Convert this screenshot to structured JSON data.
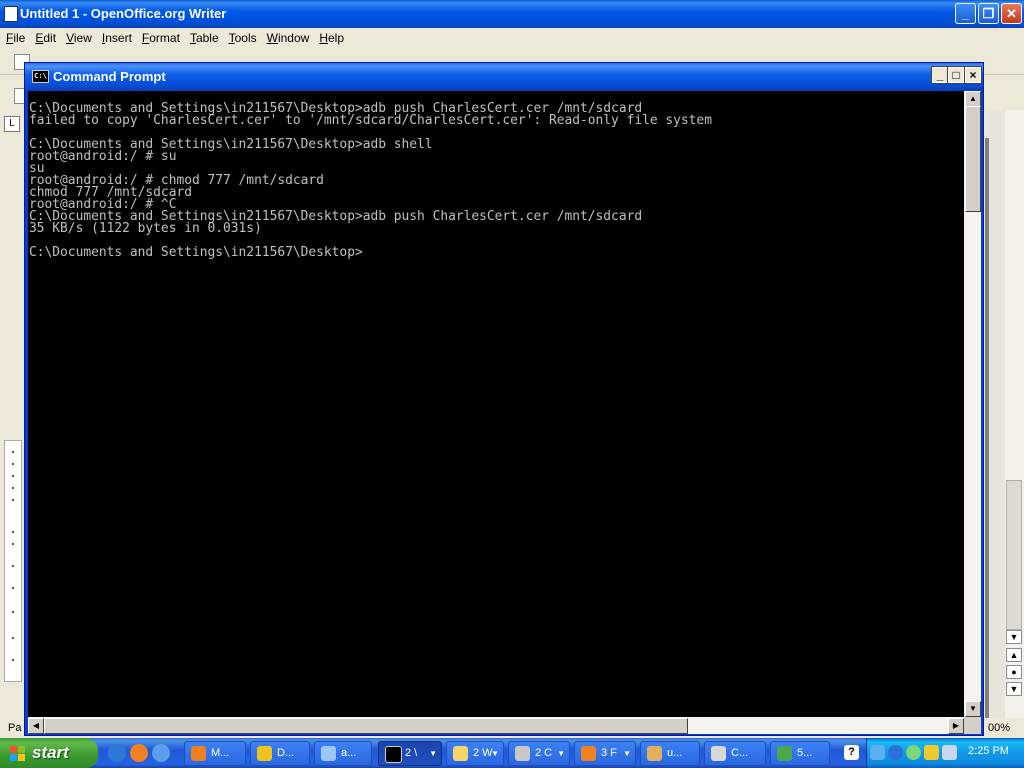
{
  "writer": {
    "title": "Untitled 1 - OpenOffice.org Writer",
    "menu": [
      "File",
      "Edit",
      "View",
      "Insert",
      "Format",
      "Table",
      "Tools",
      "Window",
      "Help"
    ],
    "status_page": "Pa",
    "zoom": "00%",
    "controls": {
      "minimize": "_",
      "restore": "❐",
      "close": "✕"
    }
  },
  "cmd": {
    "title": "Command Prompt",
    "icon_text": "C:\\",
    "controls": {
      "minimize": "_",
      "maximize": "□",
      "close": "×"
    },
    "lines": [
      "C:\\Documents and Settings\\in211567\\Desktop>adb push CharlesCert.cer /mnt/sdcard",
      "failed to copy 'CharlesCert.cer' to '/mnt/sdcard/CharlesCert.cer': Read-only file system",
      "",
      "C:\\Documents and Settings\\in211567\\Desktop>adb shell",
      "root@android:/ # su",
      "su",
      "root@android:/ # chmod 777 /mnt/sdcard",
      "chmod 777 /mnt/sdcard",
      "root@android:/ # ^C",
      "C:\\Documents and Settings\\in211567\\Desktop>adb push CharlesCert.cer /mnt/sdcard",
      "35 KB/s (1122 bytes in 0.031s)",
      "",
      "C:\\Documents and Settings\\in211567\\Desktop>"
    ]
  },
  "taskbar": {
    "start_label": "start",
    "buttons": [
      {
        "label": "M...",
        "icon": "firefox-icon",
        "color": "#f08020"
      },
      {
        "label": "D...",
        "icon": "download-icon",
        "color": "#f2c21c"
      },
      {
        "label": "a...",
        "icon": "document-icon",
        "color": "#9ec8f4"
      },
      {
        "label": "2 \\",
        "icon": "cmd-icon",
        "color": "#000000"
      },
      {
        "label": "2 W",
        "icon": "folder-icon",
        "color": "#f6d66a"
      },
      {
        "label": "2 C",
        "icon": "app-icon",
        "color": "#c8c8c8"
      },
      {
        "label": "3 F",
        "icon": "firefox-icon",
        "color": "#f08020"
      },
      {
        "label": "u...",
        "icon": "tool-icon",
        "color": "#e0b060"
      },
      {
        "label": "C...",
        "icon": "charles-icon",
        "color": "#d8d8d8"
      },
      {
        "label": "5...",
        "icon": "globe-icon",
        "color": "#4aa84a"
      }
    ],
    "clock": "2:25 PM",
    "colors": {
      "taskbar": "#245edb",
      "start": "#3c9a3c",
      "tray": "#0f8ade"
    }
  }
}
